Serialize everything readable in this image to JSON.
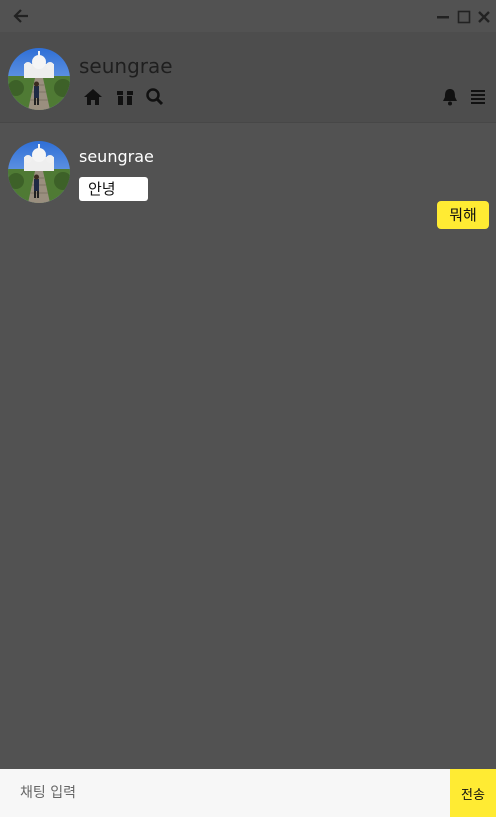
{
  "window": {
    "back_icon": "arrow-left-icon",
    "controls": [
      "minimize-icon",
      "maximize-icon",
      "close-icon"
    ]
  },
  "profile": {
    "name": "seungrae",
    "nav_icons": [
      "home-icon",
      "box-icon",
      "search-icon"
    ],
    "right_icons": [
      "bell-icon",
      "menu-icon"
    ]
  },
  "messages": [
    {
      "sender": "seungrae",
      "text": "안녕",
      "side": "left"
    },
    {
      "text": "뭐해",
      "side": "right"
    }
  ],
  "composer": {
    "placeholder": "채팅 입력",
    "send_label": "전송"
  },
  "colors": {
    "background": "#525252",
    "header": "#4d4d4d",
    "accent": "#ffeb33",
    "input_bg": "#f7f7f7"
  }
}
